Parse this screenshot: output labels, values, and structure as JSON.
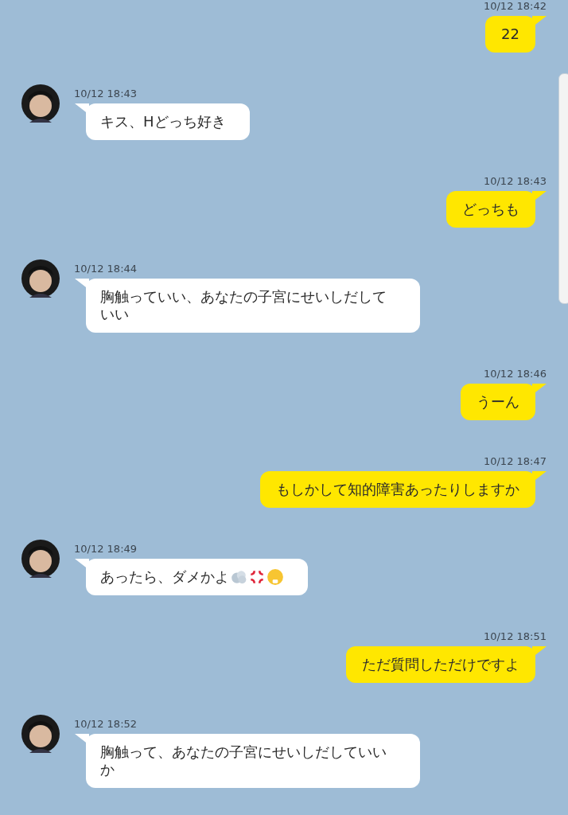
{
  "messages": [
    {
      "outgoing": true,
      "time": "10/12 18:42",
      "text": "22"
    },
    {
      "outgoing": false,
      "time": "10/12 18:43",
      "text": "キス、Hどっち好き"
    },
    {
      "outgoing": true,
      "time": "10/12 18:43",
      "text": "どっちも"
    },
    {
      "outgoing": false,
      "time": "10/12 18:44",
      "text": "胸触っていい、あなたの子宮にせいしだしていい"
    },
    {
      "outgoing": true,
      "time": "10/12 18:46",
      "text": "うーん"
    },
    {
      "outgoing": true,
      "time": "10/12 18:47",
      "text": "もしかして知的障害あったりしますか"
    },
    {
      "outgoing": false,
      "time": "10/12 18:49",
      "text": "あったら、ダメかよ",
      "kind": "emoji-trail"
    },
    {
      "outgoing": true,
      "time": "10/12 18:51",
      "text": "ただ質問しただけですよ"
    },
    {
      "outgoing": false,
      "time": "10/12 18:52",
      "text": "胸触って、あなたの子宮にせいしだしていいか"
    }
  ]
}
